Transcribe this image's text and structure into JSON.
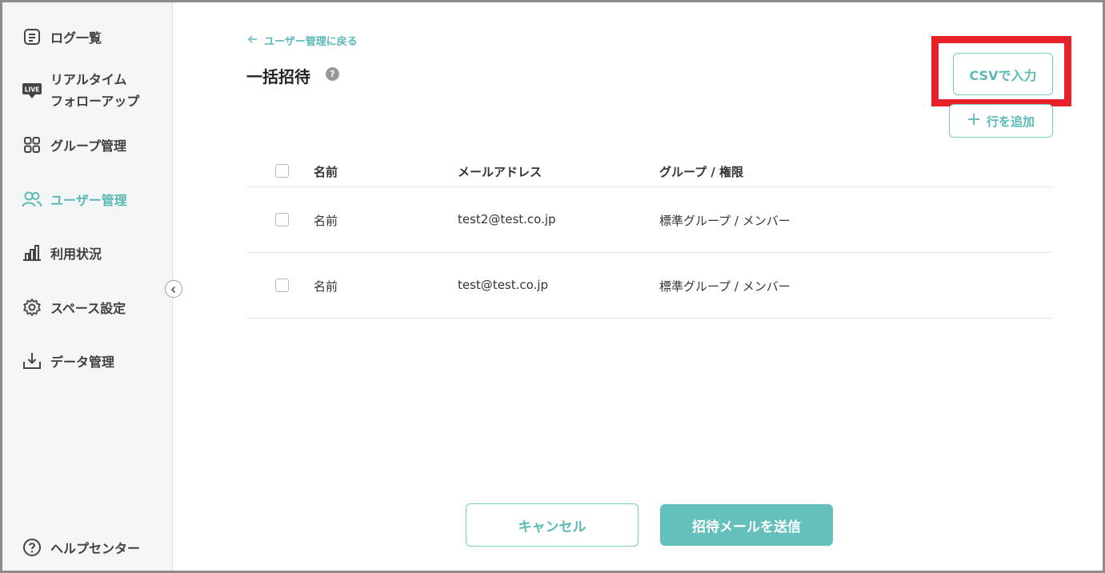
{
  "sidebar": {
    "items": [
      {
        "label": "ログ一覧",
        "icon": "log-list-icon"
      },
      {
        "label_line1": "リアルタイム",
        "label_line2": "フォローアップ",
        "icon": "live-icon",
        "badge": "LIVE"
      },
      {
        "label": "グループ管理",
        "icon": "grid-icon"
      },
      {
        "label": "ユーザー管理",
        "icon": "users-icon",
        "active": true
      },
      {
        "label": "利用状況",
        "icon": "bar-chart-icon"
      },
      {
        "label": "スペース設定",
        "icon": "gear-icon"
      },
      {
        "label": "データ管理",
        "icon": "download-tray-icon"
      }
    ],
    "help": {
      "label": "ヘルプセンター",
      "icon": "help-circle-icon"
    }
  },
  "header": {
    "back_link": "ユーザー管理に戻る",
    "title": "一括招待",
    "help_icon_glyph": "?"
  },
  "actions": {
    "csv_label": "CSVで入力",
    "add_row_label": "行を追加"
  },
  "table": {
    "columns": {
      "name": "名前",
      "email": "メールアドレス",
      "group": "グループ / 権限"
    },
    "rows": [
      {
        "name_placeholder": "名前",
        "email": "test2@test.co.jp",
        "group": "標準グループ / メンバー"
      },
      {
        "name_placeholder": "名前",
        "email": "test@test.co.jp",
        "group": "標準グループ / メンバー"
      }
    ]
  },
  "footer": {
    "cancel_label": "キャンセル",
    "send_label": "招待メールを送信"
  },
  "colors": {
    "accent": "#5bb9b5",
    "accent_fill": "#63c0bb",
    "highlight": "#e8202a",
    "sidebar_bg": "#f4f5f7"
  }
}
